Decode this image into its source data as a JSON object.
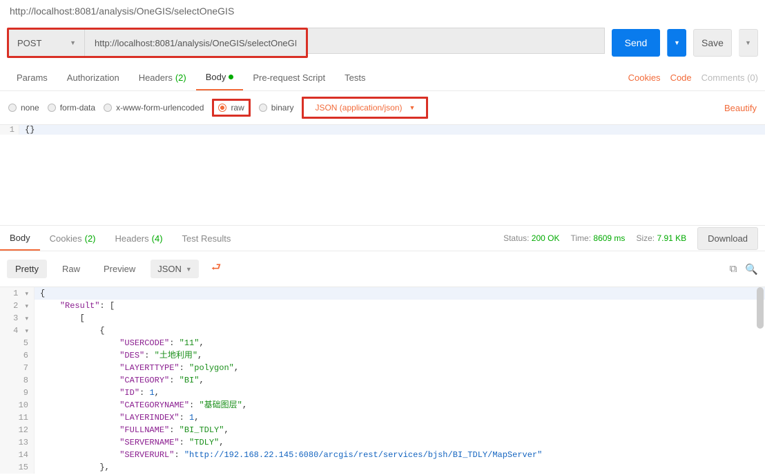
{
  "title": "http://localhost:8081/analysis/OneGIS/selectOneGIS",
  "request": {
    "method": "POST",
    "url": "http://localhost:8081/analysis/OneGIS/selectOneGIS",
    "send_label": "Send",
    "save_label": "Save"
  },
  "tabs": {
    "params": "Params",
    "auth": "Authorization",
    "headers": "Headers",
    "headers_count": "(2)",
    "body": "Body",
    "prerequest": "Pre-request Script",
    "tests": "Tests"
  },
  "right_links": {
    "cookies": "Cookies",
    "code": "Code",
    "comments": "Comments (0)"
  },
  "body_types": {
    "none": "none",
    "formdata": "form-data",
    "xwww": "x-www-form-urlencoded",
    "raw": "raw",
    "binary": "binary",
    "content_type": "JSON (application/json)",
    "beautify": "Beautify"
  },
  "editor": {
    "line1": "1",
    "code1": "{}"
  },
  "response_tabs": {
    "body": "Body",
    "cookies": "Cookies",
    "cookies_count": "(2)",
    "headers": "Headers",
    "headers_count": "(4)",
    "tests": "Test Results"
  },
  "status": {
    "status_label": "Status:",
    "status_value": "200 OK",
    "time_label": "Time:",
    "time_value": "8609 ms",
    "size_label": "Size:",
    "size_value": "7.91 KB",
    "download": "Download"
  },
  "view": {
    "pretty": "Pretty",
    "raw": "Raw",
    "preview": "Preview",
    "format": "JSON"
  },
  "response_lines": [
    {
      "n": "1",
      "fold": "▾",
      "html": "<span class='p'>{</span>"
    },
    {
      "n": "2",
      "fold": "▾",
      "html": "    <span class='k'>\"Result\"</span><span class='p'>: [</span>"
    },
    {
      "n": "3",
      "fold": "▾",
      "html": "        <span class='p'>[</span>"
    },
    {
      "n": "4",
      "fold": "▾",
      "html": "            <span class='p'>{</span>"
    },
    {
      "n": "5",
      "html": "                <span class='k'>\"USERCODE\"</span><span class='p'>: </span><span class='s'>\"11\"</span><span class='p'>,</span>"
    },
    {
      "n": "6",
      "html": "                <span class='k'>\"DES\"</span><span class='p'>: </span><span class='s'>\"土地利用\"</span><span class='p'>,</span>"
    },
    {
      "n": "7",
      "html": "                <span class='k'>\"LAYERTTYPE\"</span><span class='p'>: </span><span class='s'>\"polygon\"</span><span class='p'>,</span>"
    },
    {
      "n": "8",
      "html": "                <span class='k'>\"CATEGORY\"</span><span class='p'>: </span><span class='s'>\"BI\"</span><span class='p'>,</span>"
    },
    {
      "n": "9",
      "html": "                <span class='k'>\"ID\"</span><span class='p'>: </span><span class='n'>1</span><span class='p'>,</span>"
    },
    {
      "n": "10",
      "html": "                <span class='k'>\"CATEGORYNAME\"</span><span class='p'>: </span><span class='s'>\"基础图层\"</span><span class='p'>,</span>"
    },
    {
      "n": "11",
      "html": "                <span class='k'>\"LAYERINDEX\"</span><span class='p'>: </span><span class='n'>1</span><span class='p'>,</span>"
    },
    {
      "n": "12",
      "html": "                <span class='k'>\"FULLNAME\"</span><span class='p'>: </span><span class='s'>\"BI_TDLY\"</span><span class='p'>,</span>"
    },
    {
      "n": "13",
      "html": "                <span class='k'>\"SERVERNAME\"</span><span class='p'>: </span><span class='s'>\"TDLY\"</span><span class='p'>,</span>"
    },
    {
      "n": "14",
      "html": "                <span class='k'>\"SERVERURL\"</span><span class='p'>: </span><span class='u'>\"http://192.168.22.145:6080/arcgis/rest/services/bjsh/BI_TDLY/MapServer\"</span>"
    },
    {
      "n": "15",
      "html": "            <span class='p'>},</span>"
    }
  ]
}
